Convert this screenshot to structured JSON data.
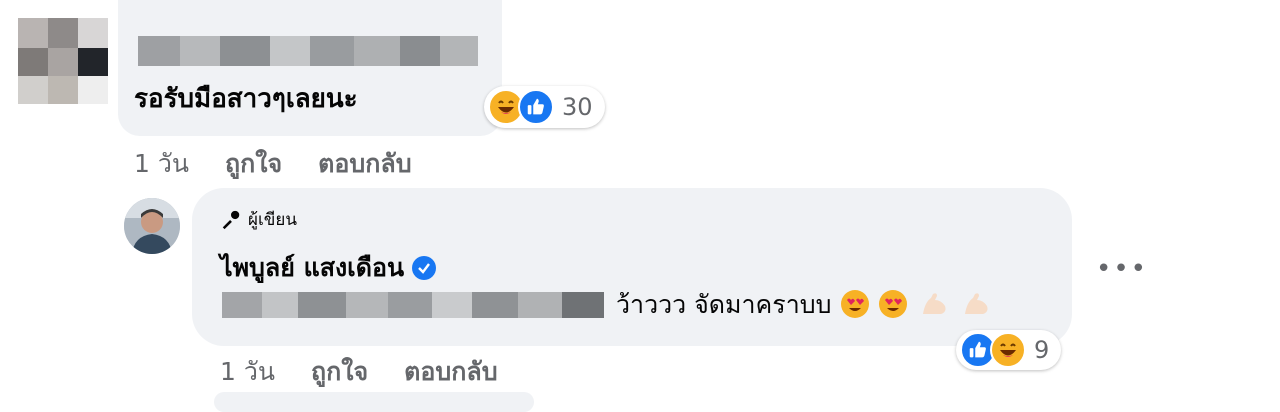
{
  "comment1": {
    "text": "รอรับมือสาวๆเลยนะ",
    "reactions": {
      "icons": [
        "laugh-emoji",
        "like-thumb"
      ],
      "count": "30"
    },
    "actions": {
      "time": "1 วัน",
      "like": "ถูกใจ",
      "reply": "ตอบกลับ"
    }
  },
  "reply": {
    "badge": "ผู้เขียน",
    "author": "ไพบูลย์ แสงเดือน",
    "text": "ว้าววว จัดมาคราบบ",
    "trailing_emoji": [
      "heart-eyes",
      "heart-eyes",
      "flexed-biceps",
      "flexed-biceps"
    ],
    "reactions": {
      "icons": [
        "like-thumb",
        "laugh-emoji"
      ],
      "count": "9"
    },
    "more": "•••",
    "actions": {
      "time": "1 วัน",
      "like": "ถูกใจ",
      "reply": "ตอบกลับ"
    }
  },
  "colors": {
    "bubble": "#f0f2f5",
    "secondary_text": "#65676b",
    "like_blue": "#1877f2",
    "emoji_yellow": "#f7b125"
  }
}
